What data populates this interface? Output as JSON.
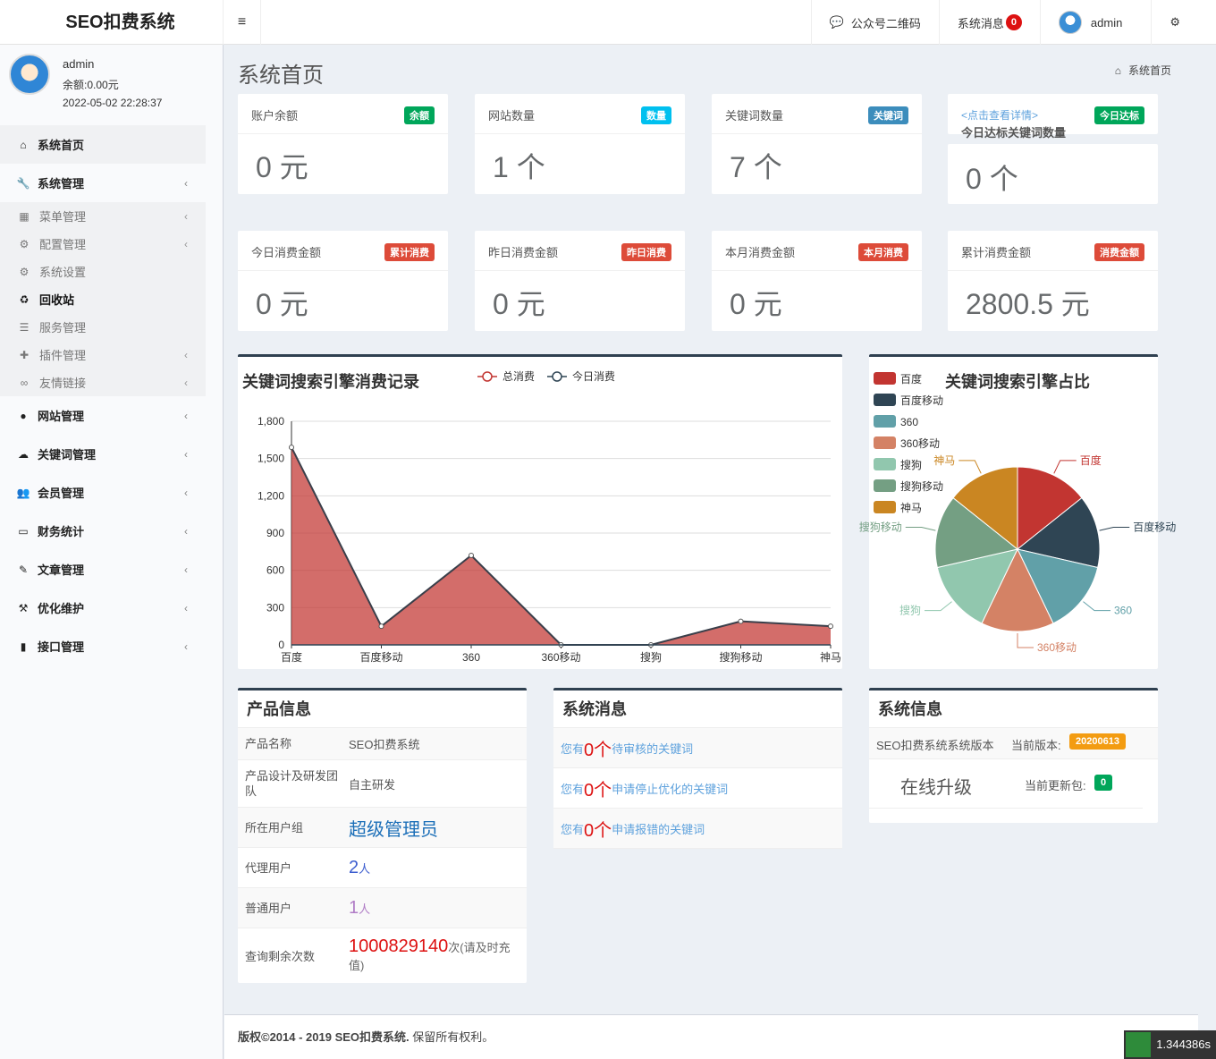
{
  "app": {
    "title": "SEO扣费系统",
    "menu_toggle": "≡"
  },
  "topnav": {
    "qrcode": "公众号二维码",
    "messages": "系统消息",
    "messages_count": "0",
    "user": "admin"
  },
  "user_panel": {
    "name": "admin",
    "balance": "余额:0.00元",
    "time": "2022-05-02 22:28:37"
  },
  "sidebar": {
    "home": "系统首页",
    "system": "系统管理",
    "sub": [
      "菜单管理",
      "配置管理",
      "系统设置",
      "回收站",
      "服务管理",
      "插件管理",
      "友情链接"
    ],
    "items": [
      "网站管理",
      "关键词管理",
      "会员管理",
      "财务统计",
      "文章管理",
      "优化维护",
      "接口管理"
    ]
  },
  "page": {
    "title": "系统首页",
    "breadcrumb": "系统首页"
  },
  "stats": [
    {
      "title": "账户余额",
      "label": "余额",
      "value": "0 元",
      "color": "#1ab394"
    },
    {
      "title": "网站数量",
      "label": "数量",
      "value": "1 个",
      "color": "#23c6c8"
    },
    {
      "title": "关键词数量",
      "label": "关键词",
      "value": "7 个",
      "color": "#3c8dbc"
    },
    {
      "title": "今日达标关键词数量",
      "link": "<点击查看详情>",
      "label": "今日达标",
      "value": "0 个",
      "color": "#00a65a"
    },
    {
      "title": "今日消费金额",
      "label": "累计消费",
      "value": "0 元",
      "color": "#dd4b39"
    },
    {
      "title": "昨日消费金额",
      "label": "昨日消费",
      "value": "0 元",
      "color": "#dd4b39"
    },
    {
      "title": "本月消费金额",
      "label": "本月消费",
      "value": "0 元",
      "color": "#dd4b39"
    },
    {
      "title": "累计消费金额",
      "label": "消费金额",
      "value": "2800.5 元",
      "color": "#dd4b39"
    }
  ],
  "chart_data": [
    {
      "type": "area",
      "title": "关键词搜索引擎消费记录",
      "categories": [
        "百度",
        "百度移动",
        "360",
        "360移动",
        "搜狗",
        "搜狗移动",
        "神马"
      ],
      "series": [
        {
          "name": "总消费",
          "values": [
            1590,
            150,
            720,
            0,
            0,
            190,
            150
          ],
          "color": "#c23531"
        },
        {
          "name": "今日消费",
          "values": [
            0,
            0,
            0,
            0,
            0,
            0,
            0
          ],
          "color": "#2f4554"
        }
      ],
      "ylim": [
        0,
        1800
      ],
      "yticks": [
        "0",
        "300",
        "600",
        "900",
        "1,200",
        "1,500",
        "1,800"
      ],
      "legend": "top-center",
      "grid": true
    },
    {
      "type": "pie",
      "title": "关键词搜索引擎占比",
      "legend": "left",
      "slices": [
        {
          "name": "百度",
          "value": 1,
          "color": "#c23531"
        },
        {
          "name": "百度移动",
          "value": 1,
          "color": "#2f4554"
        },
        {
          "name": "360",
          "value": 1,
          "color": "#61a0a8"
        },
        {
          "name": "360移动",
          "value": 1,
          "color": "#d48265"
        },
        {
          "name": "搜狗",
          "value": 1,
          "color": "#91c7ae"
        },
        {
          "name": "搜狗移动",
          "value": 1,
          "color": "#749f83"
        },
        {
          "name": "神马",
          "value": 1,
          "color": "#ca8622"
        }
      ]
    }
  ],
  "product": {
    "title": "产品信息",
    "name_k": "产品名称",
    "name_v": "SEO扣费系统",
    "team_k": "产品设计及研发团队",
    "team_v": "自主研发",
    "group_k": "所在用户组",
    "group_v": "超级管理员",
    "agent_k": "代理用户",
    "agent_n": "2",
    "agent_u": "人",
    "normal_k": "普通用户",
    "normal_n": "1",
    "normal_u": "人",
    "query_k": "查询剩余次数",
    "query_n": "1000829140",
    "query_u": "次(请及时充值)"
  },
  "messages": {
    "title": "系统消息",
    "rows": [
      {
        "pre": "您有",
        "num": "0个",
        "text": "待审核的关键词"
      },
      {
        "pre": "您有",
        "num": "0个",
        "text": "申请停止优化的关键词"
      },
      {
        "pre": "您有",
        "num": "0个",
        "text": "申请报错的关键词"
      }
    ]
  },
  "sysinfo": {
    "title": "系统信息",
    "version_label": "SEO扣费系统系统版本",
    "current_label": "当前版本:",
    "version": "20200613",
    "upgrade": "在线升级",
    "update_label": "当前更新包:",
    "update_count": "0"
  },
  "footer": {
    "copyright": "版权©2014 - 2019 SEO扣费系统.",
    "rights": "保留所有权利。",
    "timer": "1.344386s"
  }
}
